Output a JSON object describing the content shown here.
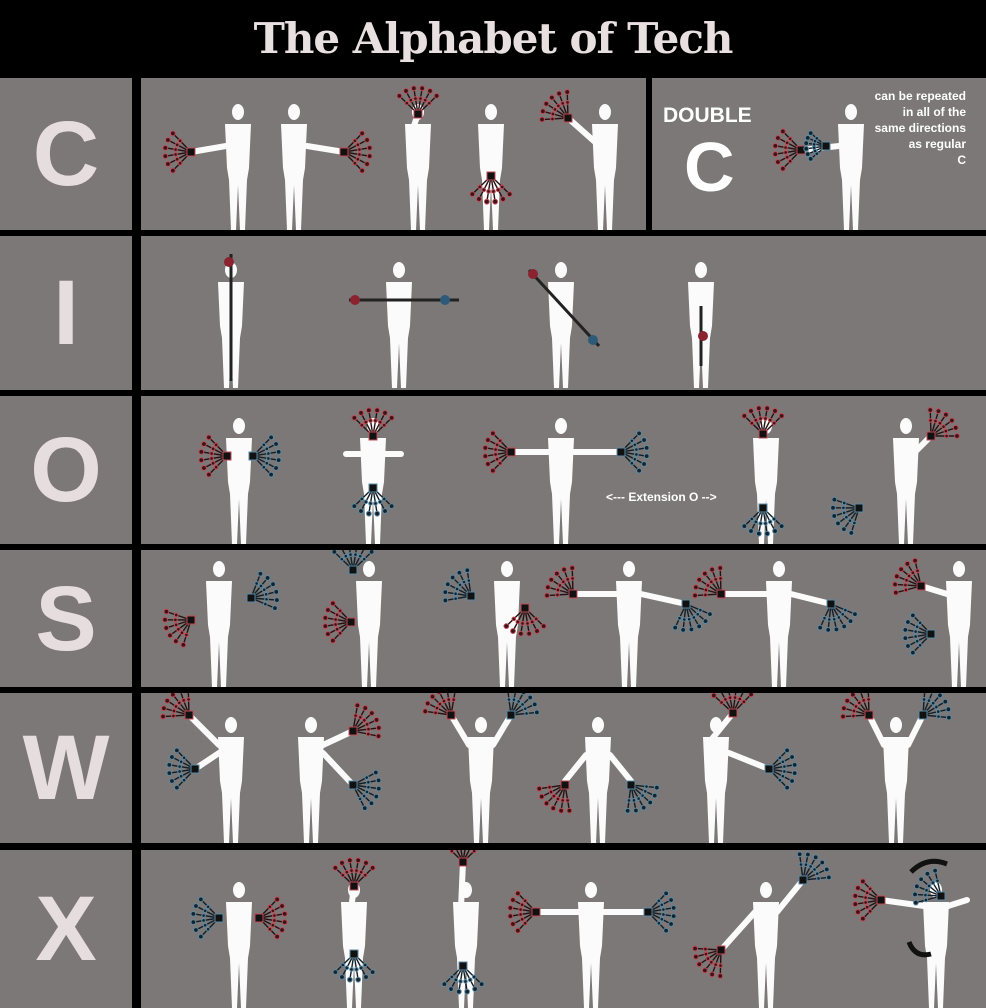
{
  "title": "The Alphabet of Tech",
  "rows": [
    {
      "letter": "C",
      "moves": 5
    },
    {
      "letter": "I",
      "moves": 4
    },
    {
      "letter": "O",
      "moves": 5
    },
    {
      "letter": "S",
      "moves": 6
    },
    {
      "letter": "W",
      "moves": 6
    },
    {
      "letter": "X",
      "moves": 6
    }
  ],
  "double_c": {
    "label": "DOUBLE",
    "letter": "C",
    "note": "can be repeated\nin all of the\nsame directions\nas regular\nC"
  },
  "extension_label": "<--- Extension O -->",
  "colors": {
    "background": "#7c7877",
    "letter": "#e6dede",
    "figure": "#fbfbfb",
    "red_glow": "#c04a55",
    "blue_glow": "#5c8aa4"
  }
}
